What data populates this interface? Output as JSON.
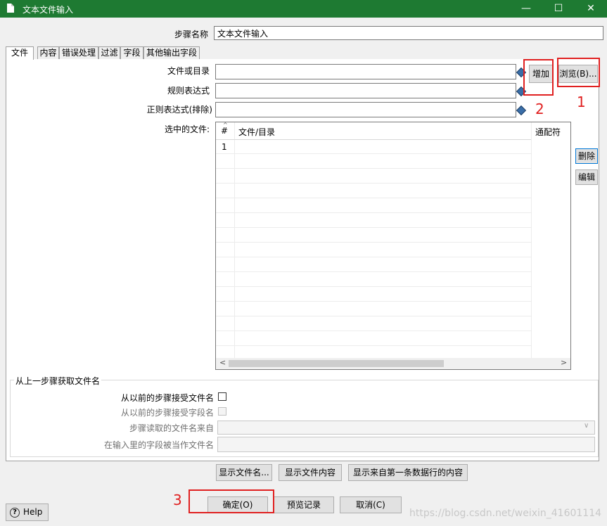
{
  "window": {
    "title": "文本文件输入",
    "min_glyph": "—",
    "max_glyph": "☐",
    "close_glyph": "✕"
  },
  "step_name": {
    "label": "步骤名称",
    "value": "文本文件输入"
  },
  "tabs": [
    {
      "label": "文件"
    },
    {
      "label": "内容"
    },
    {
      "label": "错误处理"
    },
    {
      "label": "过滤"
    },
    {
      "label": "字段"
    },
    {
      "label": "其他输出字段"
    }
  ],
  "file_tab": {
    "file_or_dir": {
      "label": "文件或目录",
      "value": ""
    },
    "regex": {
      "label": "规则表达式",
      "value": ""
    },
    "regex_exclude": {
      "label": "正则表达式(排除)",
      "value": ""
    },
    "add_button": "增加",
    "browse_button": "浏览(B)...",
    "selected_files_label": "选中的文件:",
    "table": {
      "sort_glyph": "^",
      "columns": [
        "#",
        "文件/目录",
        "通配符"
      ],
      "rows": [
        {
          "num": "1",
          "path": "",
          "wildcard": ""
        }
      ]
    },
    "delete_button": "删除",
    "edit_button": "编辑",
    "scroll_left": "<",
    "scroll_right": ">",
    "prev_step_group": {
      "title": "从上一步骤获取文件名",
      "accept_filenames": {
        "label": "从以前的步骤接受文件名",
        "checked": false
      },
      "accept_fieldname": {
        "label": "从以前的步骤接受字段名",
        "checked": false
      },
      "source_step": {
        "label": "步骤读取的文件名来自",
        "value": ""
      },
      "field_as_filename": {
        "label": "在输入里的字段被当作文件名",
        "value": ""
      }
    },
    "show_filename_button": "显示文件名...",
    "show_content_button": "显示文件内容",
    "show_first_row_button": "显示来自第一条数据行的内容"
  },
  "footer": {
    "help_button": "Help",
    "ok_button": "确定(O)",
    "preview_button": "预览记录",
    "cancel_button": "取消(C)"
  },
  "annotations": {
    "n1": "1",
    "n2": "2",
    "n3": "3",
    "color": "#e02020"
  },
  "watermark": "https://blog.csdn.net/weixin_41601114"
}
